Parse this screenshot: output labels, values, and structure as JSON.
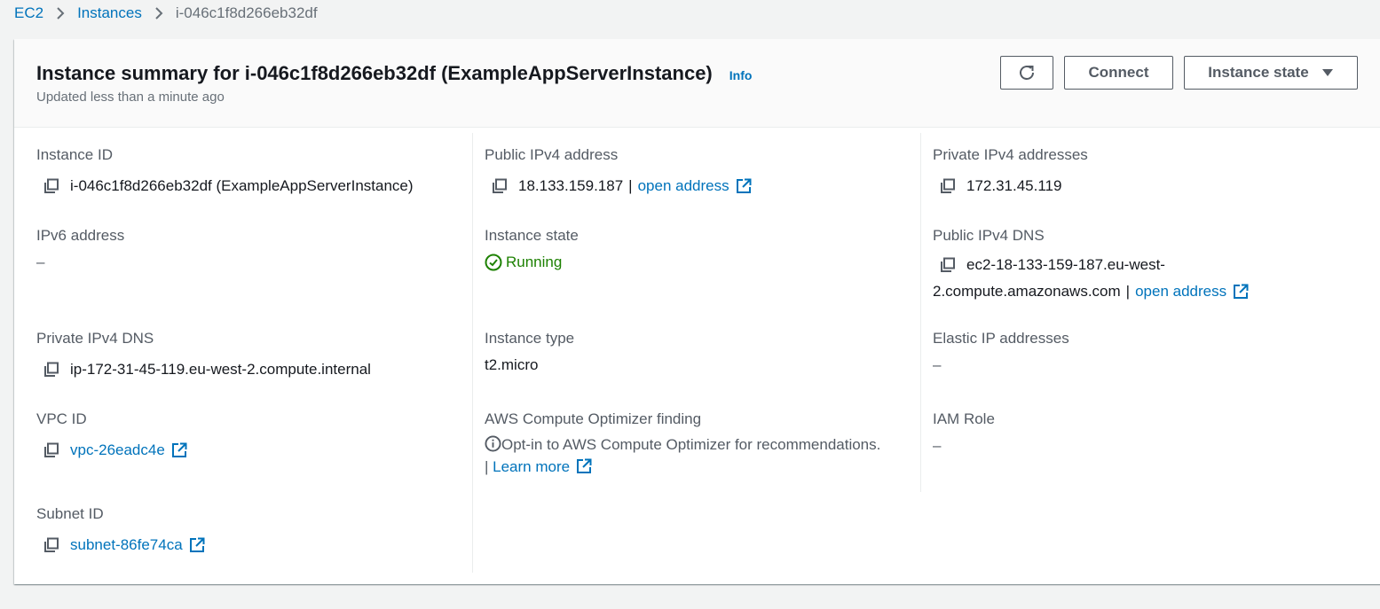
{
  "breadcrumb": {
    "items": [
      "EC2",
      "Instances"
    ],
    "current": "i-046c1f8d266eb32df"
  },
  "header": {
    "title": "Instance summary for i-046c1f8d266eb32df (ExampleAppServerInstance)",
    "info": "Info",
    "subtitle": "Updated less than a minute ago",
    "buttons": {
      "refresh_icon": "refresh-icon",
      "connect": "Connect",
      "instance_state": "Instance state"
    }
  },
  "fields": {
    "instance_id": {
      "label": "Instance ID",
      "value": "i-046c1f8d266eb32df (ExampleAppServerInstance)"
    },
    "public_ipv4": {
      "label": "Public IPv4 address",
      "value": "18.133.159.187",
      "link": "open address"
    },
    "private_ipv4": {
      "label": "Private IPv4 addresses",
      "value": "172.31.45.119"
    },
    "ipv6": {
      "label": "IPv6 address",
      "value": "–"
    },
    "instance_state": {
      "label": "Instance state",
      "value": "Running"
    },
    "public_dns": {
      "label": "Public IPv4 DNS",
      "value_line1": "ec2-18-133-159-187.eu-west-",
      "value_line2": "2.compute.amazonaws.com",
      "link": "open address"
    },
    "private_dns": {
      "label": "Private IPv4 DNS",
      "value": "ip-172-31-45-119.eu-west-2.compute.internal"
    },
    "instance_type": {
      "label": "Instance type",
      "value": "t2.micro"
    },
    "elastic_ip": {
      "label": "Elastic IP addresses",
      "value": "–"
    },
    "vpc_id": {
      "label": "VPC ID",
      "value": "vpc-26eadc4e"
    },
    "optimizer": {
      "label": "AWS Compute Optimizer finding",
      "text": "Opt-in to AWS Compute Optimizer for recommendations.",
      "link": "Learn more"
    },
    "iam_role": {
      "label": "IAM Role",
      "value": "–"
    },
    "subnet_id": {
      "label": "Subnet ID",
      "value": "subnet-86fe74ca"
    }
  },
  "colors": {
    "link": "#0073bb",
    "running": "#1d8102",
    "label": "#545b64",
    "text": "#16191f",
    "page_bg": "#f2f3f3"
  }
}
